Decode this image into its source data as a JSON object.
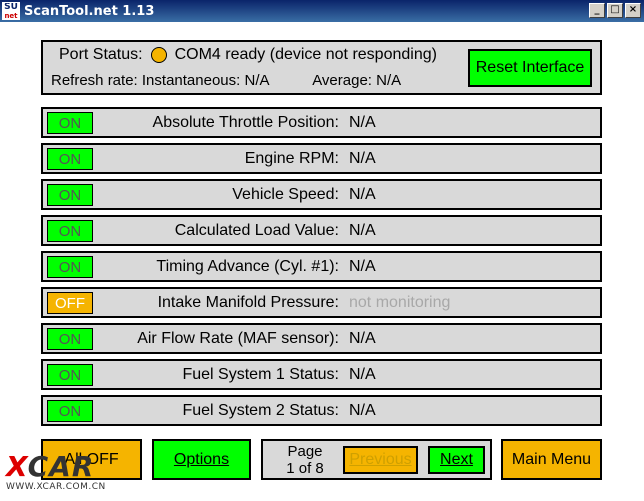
{
  "window": {
    "title": "ScanTool.net 1.13",
    "icon_text_top": "SU",
    "icon_text_bottom": "net",
    "controls": [
      "_",
      "□",
      "×"
    ]
  },
  "status": {
    "port_label": "Port Status:",
    "port_value": "COM4 ready (device not responding)",
    "indicator_color": "#f5b400",
    "refresh_label": "Refresh rate:",
    "instant_label": "Instantaneous:",
    "instant_value": "N/A",
    "average_label": "Average:",
    "average_value": "N/A",
    "reset_button": "Reset Interface"
  },
  "sensors": [
    {
      "toggle": "ON",
      "state": "on",
      "label": "Absolute Throttle Position:",
      "value": "N/A"
    },
    {
      "toggle": "ON",
      "state": "on",
      "label": "Engine RPM:",
      "value": "N/A"
    },
    {
      "toggle": "ON",
      "state": "on",
      "label": "Vehicle Speed:",
      "value": "N/A"
    },
    {
      "toggle": "ON",
      "state": "on",
      "label": "Calculated Load Value:",
      "value": "N/A"
    },
    {
      "toggle": "ON",
      "state": "on",
      "label": "Timing Advance (Cyl. #1):",
      "value": "N/A"
    },
    {
      "toggle": "OFF",
      "state": "off",
      "label": "Intake Manifold Pressure:",
      "value": "not monitoring"
    },
    {
      "toggle": "ON",
      "state": "on",
      "label": "Air Flow Rate (MAF sensor):",
      "value": "N/A"
    },
    {
      "toggle": "ON",
      "state": "on",
      "label": "Fuel System 1 Status:",
      "value": "N/A"
    },
    {
      "toggle": "ON",
      "state": "on",
      "label": "Fuel System 2 Status:",
      "value": "N/A"
    }
  ],
  "footer": {
    "all_off_button": "All OFF",
    "options_button": "Options",
    "page_label": "Page",
    "page_of": "1 of 8",
    "previous_button": "Previous",
    "next_button": "Next",
    "main_menu_button": "Main Menu"
  },
  "watermark": {
    "logo": "XCAR",
    "url": "WWW.XCAR.COM.CN"
  },
  "colors": {
    "accent_green": "#00ff00",
    "accent_orange": "#f5b400",
    "panel_gray": "#d9d9d9"
  }
}
